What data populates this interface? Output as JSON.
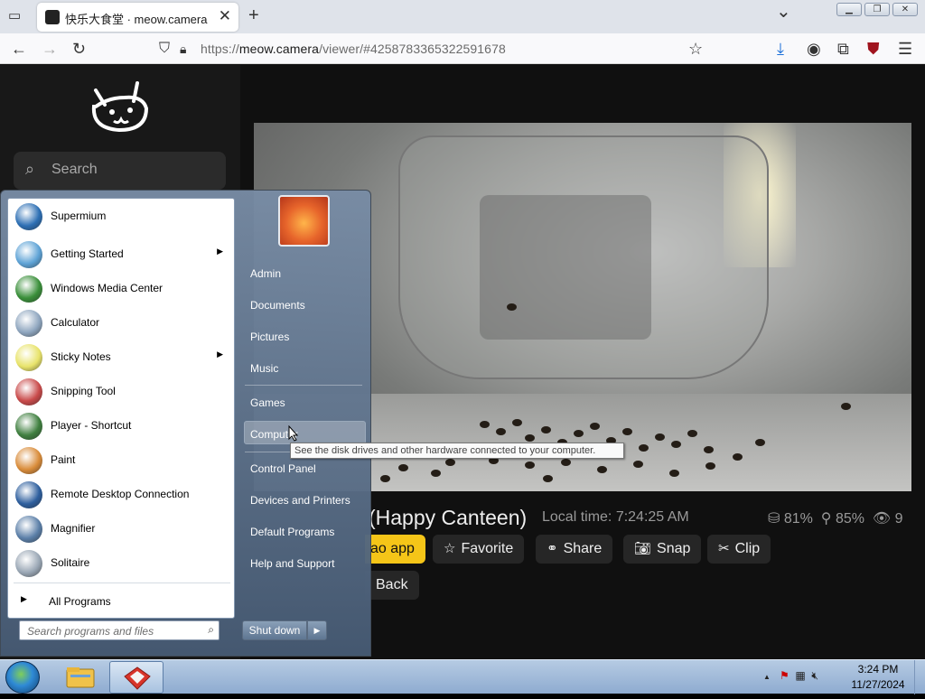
{
  "browser": {
    "tab_title": "快乐大食堂 · meow.camera",
    "tab_close": "✕",
    "new_tab": "+",
    "tab_list": "⌄",
    "url_prefix": "https://",
    "url_domain": "meow.camera",
    "url_path": "/viewer/#4258783365322591678",
    "nav_icons": [
      "back-icon",
      "forward-icon",
      "reload-icon",
      "shield-icon",
      "lock-icon",
      "star-icon",
      "download-icon",
      "account-icon",
      "extensions-icon",
      "ublock-icon",
      "menu-icon"
    ]
  },
  "site": {
    "search_placeholder": "Search",
    "camera_title": "(Happy Canteen)",
    "local_time": "Local time: 7:24:25 AM",
    "stat_food": "81%",
    "stat_battery": "85%",
    "stat_viewers": "9",
    "buttons": {
      "app": "ao app",
      "favorite": "Favorite",
      "share": "Share",
      "snap": "Snap",
      "clip": "Clip",
      "back": "Back"
    }
  },
  "start_menu": {
    "programs": [
      {
        "label": "Supermium",
        "icon": "supermium-icon",
        "color": "#2d6fb4",
        "arrow": false
      },
      {
        "label": "Getting Started",
        "icon": "getting-started-icon",
        "color": "#5ea3d6",
        "arrow": true
      },
      {
        "label": "Windows Media Center",
        "icon": "media-center-icon",
        "color": "#3a8f3a",
        "arrow": false
      },
      {
        "label": "Calculator",
        "icon": "calculator-icon",
        "color": "#8fa6bf",
        "arrow": false
      },
      {
        "label": "Sticky Notes",
        "icon": "sticky-notes-icon",
        "color": "#e8e36a",
        "arrow": true
      },
      {
        "label": "Snipping Tool",
        "icon": "snipping-tool-icon",
        "color": "#c94a4a",
        "arrow": false
      },
      {
        "label": "Player - Shortcut",
        "icon": "player-icon",
        "color": "#3f7f3f",
        "arrow": false
      },
      {
        "label": "Paint",
        "icon": "paint-icon",
        "color": "#d98c3a",
        "arrow": false
      },
      {
        "label": "Remote Desktop Connection",
        "icon": "remote-desktop-icon",
        "color": "#2e5f9e",
        "arrow": false
      },
      {
        "label": "Magnifier",
        "icon": "magnifier-icon",
        "color": "#5b7fa8",
        "arrow": false
      },
      {
        "label": "Solitaire",
        "icon": "solitaire-icon",
        "color": "#9aa7b5",
        "arrow": false
      }
    ],
    "all_programs": "All Programs",
    "search_placeholder": "Search programs and files",
    "right_items": [
      "Admin",
      "Documents",
      "Pictures",
      "Music",
      "Games",
      "Computer",
      "Control Panel",
      "Devices and Printers",
      "Default Programs",
      "Help and Support"
    ],
    "shutdown": "Shut down",
    "tooltip": "See the disk drives and other hardware connected to your computer."
  },
  "taskbar": {
    "time": "3:24 PM",
    "date": "11/27/2024",
    "tray_arrow": "▲"
  }
}
